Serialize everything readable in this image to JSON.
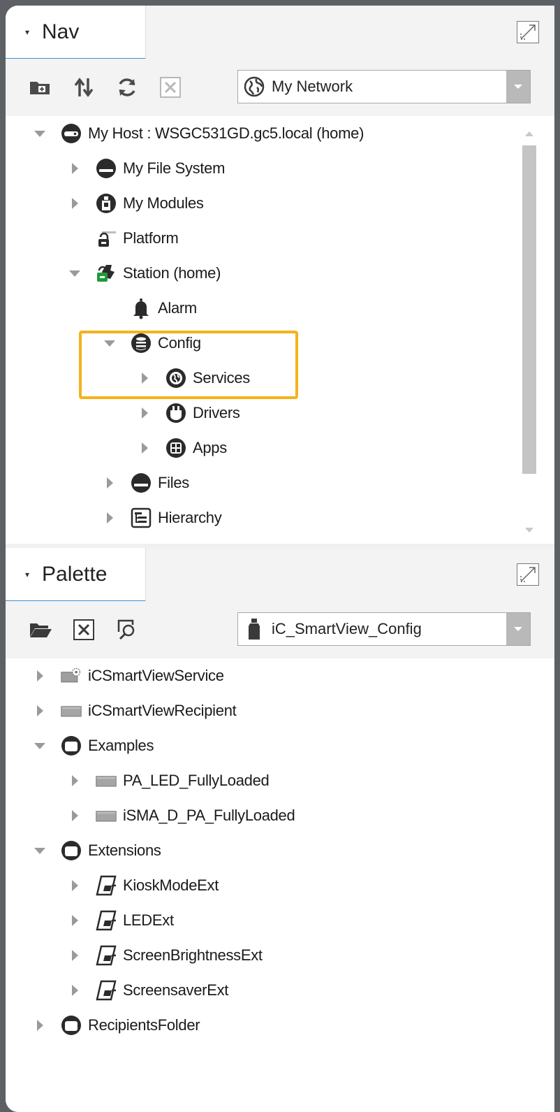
{
  "nav": {
    "title": "Nav",
    "network_combo": {
      "value": "My Network"
    },
    "tree": [
      {
        "label": "My Host : WSGC531GD.gc5.local (home)",
        "level": 0,
        "state": "expanded",
        "icon": "host-icon"
      },
      {
        "label": "My File System",
        "level": 1,
        "state": "collapsed",
        "icon": "file-system-icon"
      },
      {
        "label": "My Modules",
        "level": 1,
        "state": "collapsed",
        "icon": "modules-icon"
      },
      {
        "label": "Platform",
        "level": 1,
        "state": "leaf",
        "icon": "platform-icon"
      },
      {
        "label": "Station (home)",
        "level": 1,
        "state": "expanded",
        "icon": "station-icon"
      },
      {
        "label": "Alarm",
        "level": 2,
        "state": "leaf",
        "icon": "bell-icon"
      },
      {
        "label": "Config",
        "level": 2,
        "state": "expanded",
        "icon": "database-icon"
      },
      {
        "label": "Services",
        "level": 3,
        "state": "collapsed",
        "icon": "services-icon"
      },
      {
        "label": "Drivers",
        "level": 3,
        "state": "collapsed",
        "icon": "drivers-icon"
      },
      {
        "label": "Apps",
        "level": 3,
        "state": "collapsed",
        "icon": "apps-icon"
      },
      {
        "label": "Files",
        "level": 2,
        "state": "collapsed",
        "icon": "files-icon"
      },
      {
        "label": "Hierarchy",
        "level": 2,
        "state": "collapsed",
        "icon": "hierarchy-icon"
      }
    ]
  },
  "palette": {
    "title": "Palette",
    "module_combo": {
      "value": "iC_SmartView_Config"
    },
    "tree": [
      {
        "label": "iCSmartViewService",
        "level": 0,
        "state": "collapsed",
        "icon": "service-component-icon"
      },
      {
        "label": "iCSmartViewRecipient",
        "level": 0,
        "state": "collapsed",
        "icon": "component-icon"
      },
      {
        "label": "Examples",
        "level": 0,
        "state": "expanded",
        "icon": "folder-icon"
      },
      {
        "label": "PA_LED_FullyLoaded",
        "level": 1,
        "state": "collapsed",
        "icon": "component-icon"
      },
      {
        "label": "iSMA_D_PA_FullyLoaded",
        "level": 1,
        "state": "collapsed",
        "icon": "component-icon"
      },
      {
        "label": "Extensions",
        "level": 0,
        "state": "expanded",
        "icon": "folder-icon"
      },
      {
        "label": "KioskModeExt",
        "level": 1,
        "state": "collapsed",
        "icon": "extension-icon"
      },
      {
        "label": "LEDExt",
        "level": 1,
        "state": "collapsed",
        "icon": "extension-icon"
      },
      {
        "label": "ScreenBrightnessExt",
        "level": 1,
        "state": "collapsed",
        "icon": "extension-icon"
      },
      {
        "label": "ScreensaverExt",
        "level": 1,
        "state": "collapsed",
        "icon": "extension-icon"
      },
      {
        "label": "RecipientsFolder",
        "level": 0,
        "state": "collapsed",
        "icon": "folder-icon"
      }
    ]
  },
  "colors": {
    "highlight": "#f5b21b",
    "tab_underline": "#3a8fd6"
  }
}
